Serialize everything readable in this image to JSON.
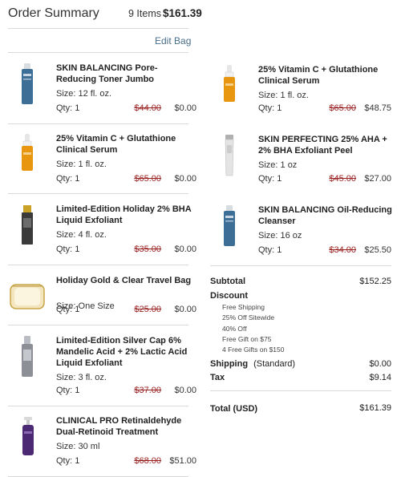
{
  "header": {
    "title": "Order Summary",
    "items_count": "9 Items",
    "total": "$161.39"
  },
  "edit_bag_label": "Edit Bag",
  "qty_prefix": "Qty: ",
  "size_prefix": "Size: ",
  "left_items": [
    {
      "name": "SKIN BALANCING Pore-Reducing Toner Jumbo",
      "size": "12 fl. oz.",
      "qty": "1",
      "original_price": "$44.00",
      "price": "$0.00",
      "product_type": "tall-bottle-blue"
    },
    {
      "name": "25% Vitamin C + Glutathione Clinical Serum",
      "size": "1 fl. oz.",
      "qty": "1",
      "original_price": "$65.00",
      "price": "$0.00",
      "product_type": "dropper-bottle-orange"
    },
    {
      "name": "Limited-Edition Holiday 2% BHA Liquid Exfoliant",
      "size": "4 fl. oz.",
      "qty": "1",
      "original_price": "$35.00",
      "price": "$0.00",
      "product_type": "bottle-black-gold"
    },
    {
      "name": "Holiday Gold & Clear Travel Bag",
      "size": "One Size",
      "qty": "1",
      "original_price": "$25.00",
      "price": "$0.00",
      "product_type": "travel-bag-gold"
    },
    {
      "name": "Limited-Edition Silver Cap 6% Mandelic Acid + 2% Lactic Acid Liquid Exfoliant",
      "size": "3 fl. oz.",
      "qty": "1",
      "original_price": "$37.00",
      "price": "$0.00",
      "product_type": "bottle-silver"
    },
    {
      "name": "CLINICAL PRO Retinaldehyde Dual-Retinoid Treatment",
      "size": "30 ml",
      "qty": "1",
      "original_price": "$68.00",
      "price": "$51.00",
      "product_type": "pump-bottle-purple"
    }
  ],
  "right_items": [
    {
      "name": "25% Vitamin C + Glutathione Clinical Serum",
      "size": "1 fl. oz.",
      "qty": "1",
      "original_price": "$65.00",
      "price": "$48.75",
      "product_type": "dropper-bottle-orange"
    },
    {
      "name": "SKIN PERFECTING 25% AHA + 2% BHA Exfoliant Peel",
      "size": "1 oz",
      "qty": "1",
      "original_price": "$45.00",
      "price": "$27.00",
      "product_type": "tube-gray"
    },
    {
      "name": "SKIN BALANCING Oil-Reducing Cleanser",
      "size": "16 oz",
      "qty": "1",
      "original_price": "$34.00",
      "price": "$25.50",
      "product_type": "tall-bottle-blue"
    }
  ],
  "summary": {
    "subtotal_label": "Subtotal",
    "subtotal": "$152.25",
    "discount_label": "Discount",
    "discounts": [
      "Free Shipping",
      "25% Off Sitewide",
      "40% Off",
      "Free Gift on $75",
      "4 Free Gifts on $150"
    ],
    "shipping_label": "Shipping",
    "shipping_method": "(Standard)",
    "shipping": "$0.00",
    "tax_label": "Tax",
    "tax": "$9.14",
    "total_label": "Total (USD)",
    "total": "$161.39"
  },
  "colors": {
    "strike_price": "#9a1f1f",
    "link": "#4a6f8a",
    "divider": "#d9d9d9"
  }
}
